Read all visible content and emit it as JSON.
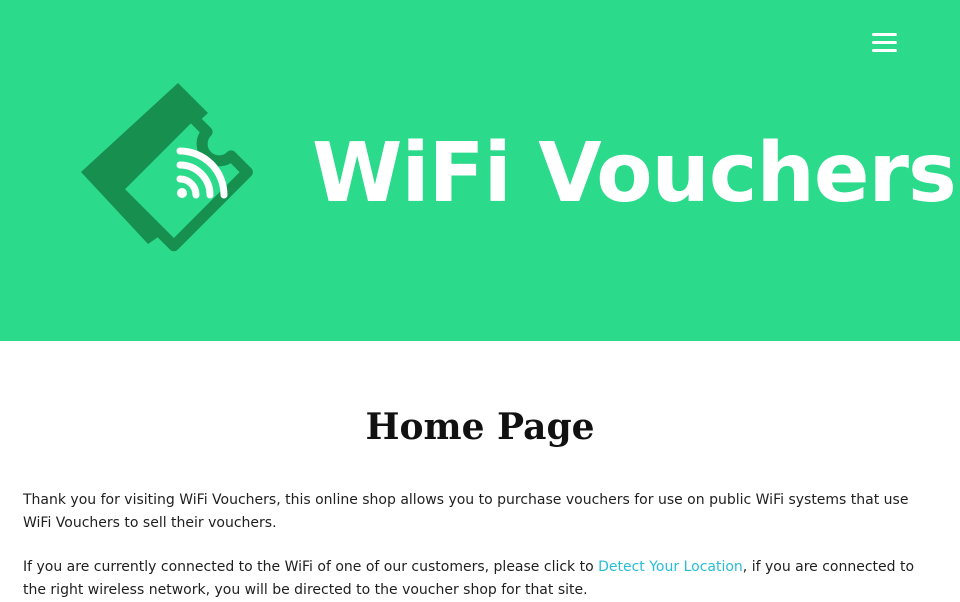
{
  "header": {
    "background": "#2bdb8b",
    "logo": {
      "text": "WiFi Vouchers",
      "icon": "wifi-ticket-icon",
      "mark_dark": "#1a8a52",
      "mark_light": "#ffffff"
    },
    "menu": {
      "icon": "hamburger-menu-icon"
    }
  },
  "main": {
    "title": "Home Page",
    "intro": "Thank you for visiting WiFi Vouchers, this online shop allows you to purchase vouchers for use on public WiFi systems that use WiFi Vouchers to sell their vouchers.",
    "detect": {
      "before": "If you are currently connected to the WiFi of one of our customers, please click to ",
      "link": "Detect Your Location",
      "after": ", if you are connected to the right wireless network, you will be directed to the voucher shop for that site."
    },
    "link_color": "#27bdd6"
  }
}
